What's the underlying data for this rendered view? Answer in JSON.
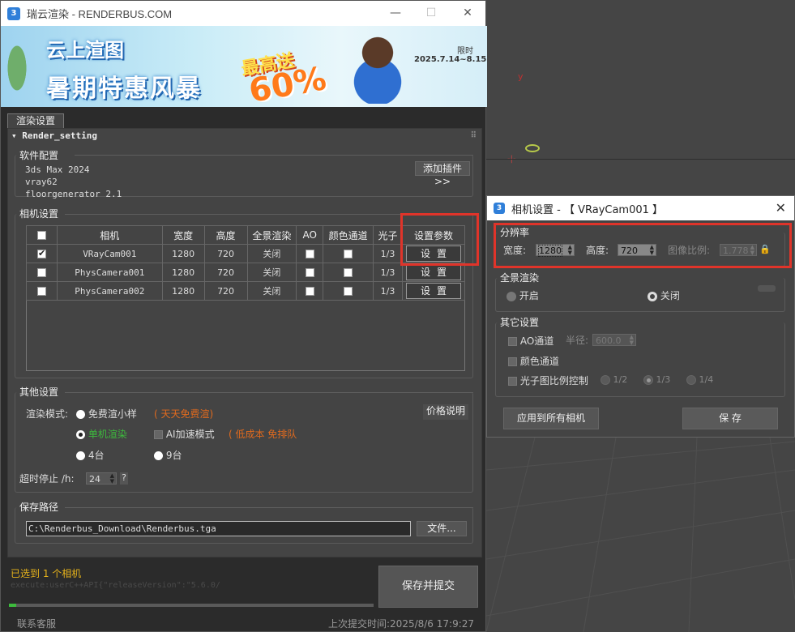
{
  "app": {
    "title": "瑞云渲染 - RENDERBUS.COM",
    "logo_text": "3",
    "window_controls": {
      "minimize": "—",
      "maximize": "☐",
      "close": "✕"
    }
  },
  "banner": {
    "line1": "云上渲图",
    "line2": "暑期特惠风暴",
    "promo_top": "最高送",
    "promo_value": "60%",
    "limit_label": "限时",
    "date_range": "2025.7.14~8.15"
  },
  "tab": {
    "label": "渲染设置"
  },
  "rollout": {
    "title": "Render_setting",
    "collapse_glyph": "▾"
  },
  "software": {
    "title": "软件配置",
    "items": [
      "3ds Max 2024",
      "vray62",
      "floorgenerator 2.1"
    ],
    "add_plugin_label": "添加插件>>"
  },
  "camera_settings": {
    "title": "相机设置",
    "columns": [
      "相机",
      "宽度",
      "高度",
      "全景渲染",
      "AO",
      "颜色通道",
      "光子",
      "设置参数"
    ],
    "rows": [
      {
        "checked": true,
        "name": "VRayCam001",
        "width": "1280",
        "height": "720",
        "panorama": "关闭",
        "ao": false,
        "color": false,
        "photon": "1/3",
        "button": "设置"
      },
      {
        "checked": false,
        "name": "PhysCamera001",
        "width": "1280",
        "height": "720",
        "panorama": "关闭",
        "ao": false,
        "color": false,
        "photon": "1/3",
        "button": "设置"
      },
      {
        "checked": false,
        "name": "PhysCamera002",
        "width": "1280",
        "height": "720",
        "panorama": "关闭",
        "ao": false,
        "color": false,
        "photon": "1/3",
        "button": "设置"
      }
    ]
  },
  "other_settings": {
    "title": "其他设置",
    "render_mode_label": "渲染模式:",
    "free_label": "免费渲小样",
    "free_note": "( 天天免费渲)",
    "price_button": "价格说明",
    "single_label": "单机渲染",
    "ai_label": "AI加速模式",
    "ai_note": "( 低成本 免排队",
    "four_label": "4台",
    "nine_label": "9台",
    "timeout_label": "超时停止 /h:",
    "timeout_value": "24",
    "help": "?"
  },
  "save_path": {
    "title": "保存路径",
    "value": "C:\\Renderbus_Download\\Renderbus.tga",
    "file_button": "文件..."
  },
  "footer": {
    "status": "已选到 1 个相机",
    "exec": "execute:userC++API{\"releaseVersion\":\"5.6.0/",
    "submit": "保存并提交",
    "contact": "联系客服",
    "last_submit": "上次提交时间:2025/8/6   17:9:27",
    "progress": 0.01
  },
  "camera_dialog": {
    "title": "相机设置 - 【 VRayCam001 】",
    "resolution": {
      "title": "分辨率",
      "width_label": "宽度:",
      "width_value": "1280",
      "height_label": "高度:",
      "height_value": "720",
      "aspect_label": "图像比例:",
      "aspect_value": "1.778"
    },
    "panorama": {
      "title": "全景渲染",
      "on": "开启",
      "off": "关闭"
    },
    "other": {
      "title": "其它设置",
      "ao_label": "AO通道",
      "radius_label": "半径:",
      "radius_value": "600.0",
      "color_label": "颜色通道",
      "photon_label": "光子图比例控制",
      "photon_options": [
        "1/2",
        "1/3",
        "1/4"
      ]
    },
    "apply_all": "应用到所有相机",
    "save": "保 存"
  },
  "viewport": {
    "axis_label": "y"
  },
  "colors": {
    "highlight": "#e0342a",
    "accent_orange": "#e06a1e",
    "status_yellow": "#e5b21b",
    "green": "#3dbb3d"
  }
}
